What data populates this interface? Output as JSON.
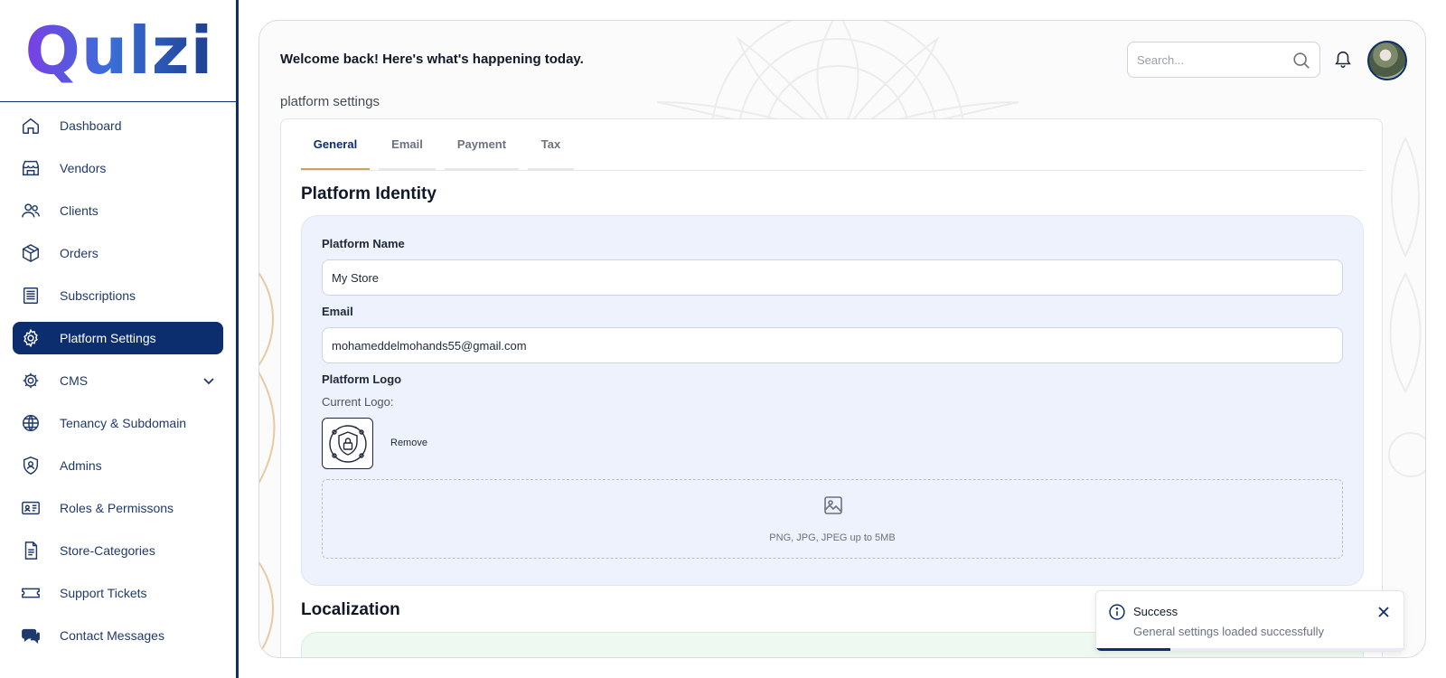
{
  "brand": {
    "logo_text": "Qulzi"
  },
  "sidebar": {
    "items": [
      {
        "label": "Dashboard",
        "icon": "home-icon"
      },
      {
        "label": "Vendors",
        "icon": "store-icon"
      },
      {
        "label": "Clients",
        "icon": "users-icon"
      },
      {
        "label": "Orders",
        "icon": "box-icon"
      },
      {
        "label": "Subscriptions",
        "icon": "receipt-icon"
      },
      {
        "label": "Platform Settings",
        "icon": "gear-icon",
        "active": true
      },
      {
        "label": "CMS",
        "icon": "cog-icon",
        "expandable": true
      },
      {
        "label": "Tenancy & Subdomain",
        "icon": "globe-icon"
      },
      {
        "label": "Admins",
        "icon": "shield-user-icon"
      },
      {
        "label": "Roles & Permissons",
        "icon": "id-card-icon"
      },
      {
        "label": "Store-Categories",
        "icon": "document-icon"
      },
      {
        "label": "Support Tickets",
        "icon": "ticket-icon"
      },
      {
        "label": "Contact Messages",
        "icon": "chat-icon"
      }
    ]
  },
  "header": {
    "welcome": "Welcome back! Here's what's happening today.",
    "search_placeholder": "Search...",
    "breadcrumb": "platform settings"
  },
  "tabs": [
    {
      "label": "General",
      "active": true
    },
    {
      "label": "Email"
    },
    {
      "label": "Payment"
    },
    {
      "label": "Tax"
    }
  ],
  "identity": {
    "title": "Platform Identity",
    "name_label": "Platform Name",
    "name_value": "My Store",
    "email_label": "Email",
    "email_value": "mohameddelmohands55@gmail.com",
    "logo_label": "Platform Logo",
    "current_logo_label": "Current Logo:",
    "remove_label": "Remove",
    "dropzone_hint": "PNG, JPG, JPEG up to 5MB"
  },
  "localization": {
    "title": "Localization"
  },
  "toast": {
    "title": "Success",
    "message": "General settings loaded successfully",
    "progress": 0.24
  },
  "colors": {
    "primary": "#0d2e6e",
    "tab_underline": "#c8a464",
    "identity_bg": "#edf2fc",
    "localization_bg": "#eefaf1"
  }
}
